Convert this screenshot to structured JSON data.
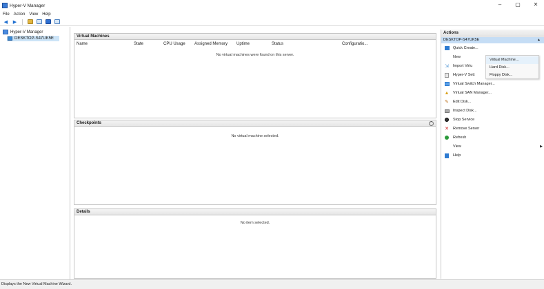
{
  "window": {
    "title": "Hyper-V Manager",
    "controls": [
      "–",
      "▢",
      "✕"
    ]
  },
  "menu": {
    "items": [
      "File",
      "Action",
      "View",
      "Help"
    ]
  },
  "toolbar": {
    "icons": [
      "back-arrow-icon",
      "forward-arrow-icon",
      "folder-icon",
      "console-tree-icon",
      "help-icon",
      "show-hide-icon"
    ]
  },
  "tree": {
    "root": "Hyper-V Manager",
    "server": "DESKTOP-S47UK5E"
  },
  "vm_section": {
    "title": "Virtual Machines",
    "columns": [
      "Name",
      "State",
      "CPU Usage",
      "Assigned Memory",
      "Uptime",
      "Status",
      "Configuratio..."
    ],
    "empty_message": "No virtual machines were found on this server."
  },
  "checkpoints_section": {
    "title": "Checkpoints",
    "empty_message": "No virtual machine selected."
  },
  "details_section": {
    "title": "Details",
    "empty_message": "No item selected."
  },
  "actions": {
    "title": "Actions",
    "server": "DESKTOP-S47UK5E",
    "items": [
      {
        "label": "Quick Create...",
        "icon": "quick-create-icon",
        "color": "#2e7bd1"
      },
      {
        "label": "New",
        "icon": "",
        "color": ""
      },
      {
        "label": "Import Virtu",
        "icon": "import-icon",
        "color": "#5a9bd6"
      },
      {
        "label": "Hyper-V Sett",
        "icon": "settings-icon",
        "color": "#888888"
      },
      {
        "label": "Virtual Switch Manager...",
        "icon": "switch-icon",
        "color": "#2e7bd1"
      },
      {
        "label": "Virtual SAN Manager...",
        "icon": "san-icon",
        "color": "#d9a21b"
      },
      {
        "label": "Edit Disk...",
        "icon": "edit-disk-icon",
        "color": "#c07a2a"
      },
      {
        "label": "Inspect Disk...",
        "icon": "inspect-disk-icon",
        "color": "#888888"
      },
      {
        "label": "Stop Service",
        "icon": "stop-icon",
        "color": "#333333"
      },
      {
        "label": "Remove Server",
        "icon": "remove-icon",
        "color": "#d11b1b"
      },
      {
        "label": "Refresh",
        "icon": "refresh-icon",
        "color": "#2a9a3a"
      },
      {
        "label": "View",
        "icon": "",
        "color": ""
      },
      {
        "label": "Help",
        "icon": "help-icon",
        "color": "#2e7bd1"
      }
    ]
  },
  "context_menu": {
    "items": [
      "Virtual Machine...",
      "Hard Disk...",
      "Floppy Disk..."
    ]
  },
  "status_bar": {
    "text": "Displays the New Virtual Machine Wizard."
  }
}
